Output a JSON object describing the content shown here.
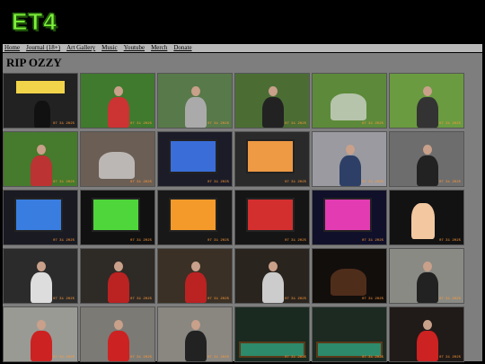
{
  "site": {
    "logo": "ET4"
  },
  "nav": {
    "items": [
      "Home",
      "Journal (18+)",
      "Art Gallery",
      "Music",
      "Youtube",
      "Merch",
      "Donate"
    ]
  },
  "page": {
    "title": "RIP OZZY"
  },
  "gallery": {
    "thumbs": [
      {
        "bg": "#222",
        "accent": "#f2d44a",
        "scene": "sign",
        "stamp": "07 31 2025"
      },
      {
        "bg": "#3f7a2e",
        "accent": "#c33",
        "scene": "person",
        "stamp": "07 31 2025"
      },
      {
        "bg": "#58794a",
        "accent": "#aaa",
        "scene": "person",
        "stamp": "07 31 2025"
      },
      {
        "bg": "#4b6d34",
        "accent": "#222",
        "scene": "person",
        "stamp": "07 31 2025"
      },
      {
        "bg": "#5d8a3a",
        "accent": "#ddd",
        "scene": "chair",
        "stamp": "07 31 2025"
      },
      {
        "bg": "#6a9b40",
        "accent": "#333",
        "scene": "person",
        "stamp": "07 31 2025"
      },
      {
        "bg": "#467a2c",
        "accent": "#b33",
        "scene": "person",
        "stamp": "07 31 2025"
      },
      {
        "bg": "#6b5e55",
        "accent": "#ddd",
        "scene": "room",
        "stamp": "07 31 2025"
      },
      {
        "bg": "#1c1c28",
        "accent": "#3a6dd8",
        "scene": "slot",
        "stamp": "07 31 2025"
      },
      {
        "bg": "#2a2a2a",
        "accent": "#e94",
        "scene": "slot",
        "stamp": "07 31 2025"
      },
      {
        "bg": "#9a9aa0",
        "accent": "#2d3f66",
        "scene": "person",
        "stamp": "07 31 2025"
      },
      {
        "bg": "#6d6d6d",
        "accent": "#222",
        "scene": "person",
        "stamp": "07 31 2025"
      },
      {
        "bg": "#1a1a22",
        "accent": "#3a7de0",
        "scene": "slot",
        "stamp": "07 31 2025"
      },
      {
        "bg": "#111",
        "accent": "#4fd63a",
        "scene": "slot",
        "stamp": "07 31 2025"
      },
      {
        "bg": "#181818",
        "accent": "#f39a2a",
        "scene": "slot",
        "stamp": "07 31 2025"
      },
      {
        "bg": "#151515",
        "accent": "#d32f2f",
        "scene": "slot",
        "stamp": "07 31 2025"
      },
      {
        "bg": "#10102a",
        "accent": "#e33cb3",
        "scene": "slot",
        "stamp": "07 31 2025"
      },
      {
        "bg": "#121212",
        "accent": "#f3c7a0",
        "scene": "hand",
        "stamp": "07 31 2025"
      },
      {
        "bg": "#2b2b2b",
        "accent": "#ddd",
        "scene": "person",
        "stamp": "07 31 2025"
      },
      {
        "bg": "#2e2a26",
        "accent": "#b22",
        "scene": "person",
        "stamp": "07 31 2025"
      },
      {
        "bg": "#3a3025",
        "accent": "#b22",
        "scene": "person",
        "stamp": "07 31 2025"
      },
      {
        "bg": "#2a241e",
        "accent": "#ccc",
        "scene": "person",
        "stamp": "07 31 2025"
      },
      {
        "bg": "#120e0c",
        "accent": "#6a3a22",
        "scene": "room",
        "stamp": "07 31 2025"
      },
      {
        "bg": "#8a8a84",
        "accent": "#222",
        "scene": "person",
        "stamp": "07 31 2025"
      },
      {
        "bg": "#9a9a94",
        "accent": "#c22",
        "scene": "person",
        "stamp": "07 31 2025"
      },
      {
        "bg": "#7c7a74",
        "accent": "#c22",
        "scene": "person",
        "stamp": "07 31 2025"
      },
      {
        "bg": "#8a8680",
        "accent": "#222",
        "scene": "person",
        "stamp": "07 31 2025"
      },
      {
        "bg": "#1a2a20",
        "accent": "#2d8a6a",
        "scene": "pool",
        "stamp": "07 31 2025"
      },
      {
        "bg": "#1c2a22",
        "accent": "#2d8a6a",
        "scene": "pool",
        "stamp": "07 31 2025"
      },
      {
        "bg": "#201a18",
        "accent": "#c22",
        "scene": "person",
        "stamp": "07 31 2025"
      }
    ]
  }
}
